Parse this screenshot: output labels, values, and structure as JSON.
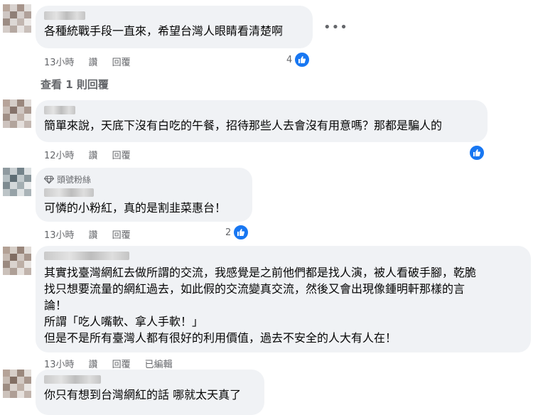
{
  "comments": [
    {
      "text": "各種統戰手段一直來，希望台灣人眼睛看清楚啊",
      "time": "13小時",
      "like": "讚",
      "reply": "回覆",
      "reaction_count": "4"
    },
    {
      "text": "簡單來說，天底下沒有白吃的午餐，招待那些人去會沒有用意嗎？那都是騙人的",
      "time": "12小時",
      "like": "讚",
      "reply": "回覆",
      "reaction_count": ""
    },
    {
      "badge": "頭號粉絲",
      "text": "可憐的小粉紅，真的是割韭菜惠台！",
      "time": "13小時",
      "like": "讚",
      "reply": "回覆",
      "reaction_count": "2"
    },
    {
      "text": "其實找臺灣網紅去做所謂的交流，我感覺是之前他們都是找人演，被人看破手腳，乾脆\n找只想要流量的網紅過去，如此假的交流變真交流，然後又會出現像鍾明軒那樣的言\n論！\n所謂「吃人嘴軟、拿人手軟！」\n但是不是所有臺灣人都有很好的利用價值，過去不安全的人大有人在！",
      "time": "13小時",
      "like": "讚",
      "reply": "回覆",
      "edited": "已編輯"
    },
    {
      "text": "你只有想到台灣網紅的話 哪就太天真了"
    }
  ],
  "view_replies": "查看 1 則回覆",
  "more_options": "•••",
  "icons": {
    "like": "like-thumb-icon",
    "badge": "diamond-icon",
    "more": "more-options-icon"
  },
  "colors": {
    "bubble": "#f0f2f5",
    "like_blue": "#1877f2",
    "meta_text": "#65676b"
  }
}
